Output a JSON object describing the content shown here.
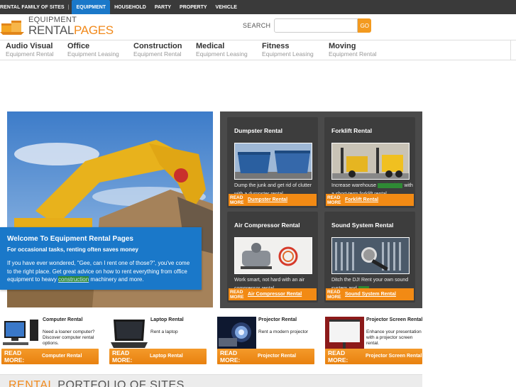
{
  "topbar": {
    "family_label": "RENTAL FAMILY OF SITES",
    "separator": "|",
    "tabs": [
      {
        "label": "EQUIPMENT",
        "active": true
      },
      {
        "label": "HOUSEHOLD",
        "active": false
      },
      {
        "label": "PARTY",
        "active": false
      },
      {
        "label": "PROPERTY",
        "active": false
      },
      {
        "label": "VEHICLE",
        "active": false
      }
    ]
  },
  "logo": {
    "line1": "EQUIPMENT",
    "line2a": "RENTAL",
    "line2b": "PAGES"
  },
  "search": {
    "label": "SEARCH",
    "placeholder": "",
    "value": "",
    "go_label": "GO"
  },
  "categories": [
    {
      "title": "Audio Visual",
      "sub": "Equipment Rental"
    },
    {
      "title": "Office",
      "sub": "Equipment Leasing"
    },
    {
      "title": "Construction",
      "sub": "Equipment Rental"
    },
    {
      "title": "Medical",
      "sub": "Equipment Leasing"
    },
    {
      "title": "Fitness",
      "sub": "Equipment Leasing"
    },
    {
      "title": "Moving",
      "sub": "Equipment Rental"
    }
  ],
  "welcome": {
    "heading": "Welcome To Equipment Rental Pages",
    "subheading": "For occasional tasks, renting often saves money",
    "body_before": "If you have ever wondered, \"Gee, can I rent one of those?\", you've come to the right place. Get great advice on how to rent everything from office equipment to heavy ",
    "link": "construction",
    "body_after": " machinery and more."
  },
  "cards": [
    {
      "title": "Dumpster Rental",
      "desc": "Dump the junk and get rid of clutter with a dumpster rental.",
      "read_more": "READ MORE",
      "link": "Dumpster Rental"
    },
    {
      "title": "Forklift Rental",
      "desc_before": "Increase warehouse ",
      "desc_hl": "productivity",
      "desc_after": " with a short-term forklift rental.",
      "read_more": "READ MORE",
      "link": "Forklift Rental"
    },
    {
      "title": "Air Compressor Rental",
      "desc": "Work smart, not hard with an air compressor rental.",
      "read_more": "READ MORE",
      "link": "Air Compressor Rental"
    },
    {
      "title": "Sound System Rental",
      "desc_before": "Ditch the DJ! Rent your own sound system and ",
      "desc_hl": "party",
      "desc_after": ".",
      "read_more": "READ MORE",
      "link": "Sound System Rental"
    }
  ],
  "products": [
    {
      "title": "Computer Rental",
      "desc": "Need a loaner computer? Discover computer rental options.",
      "read_more": "READ MORE:",
      "link": "Computer Rental"
    },
    {
      "title": "Laptop Rental",
      "desc": "Rent a laptop",
      "read_more": "READ MORE:",
      "link": "Laptop Rental"
    },
    {
      "title": "Projector Rental",
      "desc": "Rent a modern projector",
      "read_more": "READ MORE:",
      "link": "Projector Rental"
    },
    {
      "title": "Projector Screen Rental",
      "desc": "Enhance your presentation with a projector screen rental.",
      "read_more": "READ MORE:",
      "link": "Projector Screen Rental"
    }
  ],
  "portfolio": {
    "orange": "RENTAL",
    "rest": " PORTFOLIO OF SITES"
  },
  "colors": {
    "accent_blue": "#1a78c9",
    "accent_orange": "#f28a14",
    "highlight_green": "#2f8a35"
  }
}
